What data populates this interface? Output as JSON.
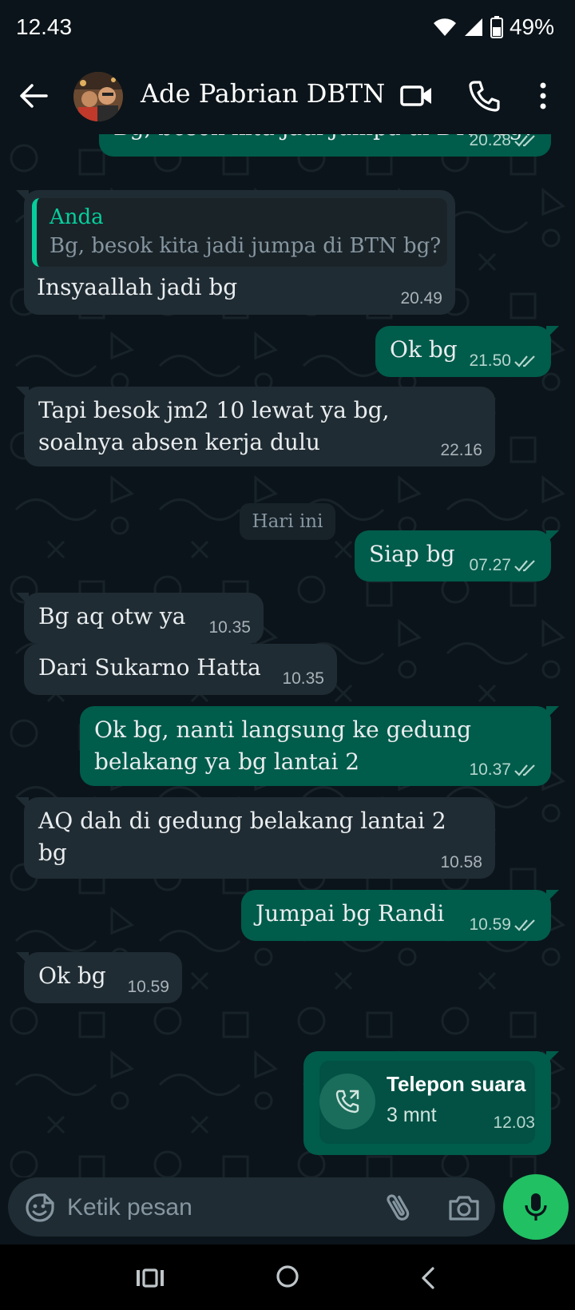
{
  "status": {
    "time": "12.43",
    "battery": "49%"
  },
  "header": {
    "contact_name": "Ade Pabrian DBTN"
  },
  "messages": [
    {
      "text": "Bg, besok kita jadi jumpa di BTN bg?",
      "time": "20.28"
    },
    {
      "quote_author": "Anda",
      "quote_text": "Bg, besok kita jadi jumpa di BTN bg?",
      "text": "Insyaallah jadi bg",
      "time": "20.49"
    },
    {
      "text": "Ok bg",
      "time": "21.50"
    },
    {
      "text_line1": "Tapi besok jm2 10 lewat ya bg,",
      "text_line2": "soalnya absen kerja dulu",
      "time": "22.16"
    },
    {
      "text": "Siap bg",
      "time": "07.27"
    },
    {
      "text": "Bg aq otw ya",
      "time": "10.35"
    },
    {
      "text": "Dari Sukarno Hatta",
      "time": "10.35"
    },
    {
      "text_line1": "Ok bg, nanti langsung ke gedung",
      "text_line2": "belakang ya bg lantai 2",
      "time": "10.37"
    },
    {
      "text_line1": "AQ dah di gedung belakang lantai 2",
      "text_line2": "bg",
      "time": "10.58"
    },
    {
      "text": "Jumpai bg Randi",
      "time": "10.59"
    },
    {
      "text": "Ok bg",
      "time": "10.59"
    }
  ],
  "day_separator": "Hari ini",
  "call": {
    "title": "Telepon suara",
    "duration": "3 mnt",
    "time": "12.03"
  },
  "input": {
    "placeholder": "Ketik pesan"
  },
  "colors": {
    "background": "#0b141a",
    "incoming": "#202c33",
    "outgoing": "#005c4b",
    "accent": "#21c063",
    "quote_bar": "#06cf9c"
  },
  "icons": {
    "status": [
      "wifi-icon",
      "signal-icon",
      "battery-icon"
    ],
    "header": [
      "back-arrow-icon",
      "avatar",
      "video-call-icon",
      "phone-icon",
      "more-vertical-icon"
    ],
    "input": [
      "emoji-icon",
      "attach-icon",
      "camera-icon",
      "mic-icon"
    ],
    "nav": [
      "recents-icon",
      "home-icon",
      "nav-back-icon"
    ]
  }
}
